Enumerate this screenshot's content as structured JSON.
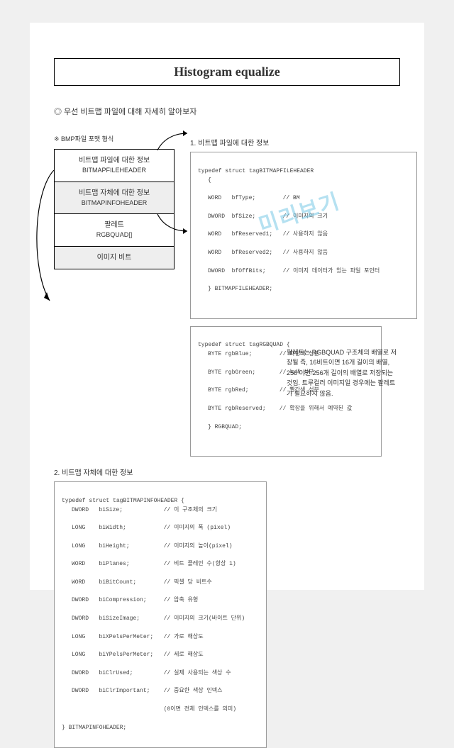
{
  "title": "Histogram  equalize",
  "intro": "◎ 우선 비트맵 파일에 대해 자세히 알아보자",
  "subhead_left": "※ BMP파일 포맷 형식",
  "sec1_heading": "1. 비트맵 파일에 대한 정보",
  "stack": {
    "cell1": {
      "line1": "비트맵 파일에 대한 정보",
      "line2": "BITMAPFILEHEADER"
    },
    "cell2": {
      "line1": "비트맵 자체에 대한 정보",
      "line2": "BITMAPINFOHEADER"
    },
    "cell3": {
      "line1": "팔레트",
      "line2": "RGBQUAD[]"
    },
    "cell4": {
      "line1": "이미지 비트"
    }
  },
  "code_fileheader": {
    "open": "typedef struct tagBITMAPFILEHEADER",
    "brace": "{",
    "m1": "WORD   bfType;        // BM",
    "m2": "DWORD  bfSize;        // 이미지의 크기",
    "m3": "WORD   bfReserved1;   // 사용하지 않음",
    "m4": "WORD   bfReserved2;   // 사용하지 않음",
    "m5": "DWORD  bfOffBits;     // 이미지 데이터가 있는 파일 포인터",
    "close": "} BITMAPFILEHEADER;"
  },
  "code_rgbquad": {
    "open": "typedef struct tagRGBQUAD {",
    "m1": "BYTE rgbBlue;        // 파란색 성분",
    "m2": "BYTE rgbGreen;       // 녹색 성분",
    "m3": "BYTE rgbRed;         // 빨간색 성분",
    "m4": "BYTE rgbReserved;    // 확장을 위해서 예약된 값",
    "close": "} RGBQUAD;"
  },
  "sec2_heading": "2. 비트맵 자체에 대한 정보",
  "code_infoheader": {
    "open": "typedef struct tagBITMAPINFOHEADER {",
    "m1": "DWORD   biSize;            // 이 구조체의 크기",
    "m2": "LONG    biWidth;           // 이미지의 폭 (pixel)",
    "m3": "LONG    biHeight;          // 이미지의 높이(pixel)",
    "m4": "WORD    biPlanes;          // 비트 플레인 수(항상 1)",
    "m5": "WORD    biBitCount;        // 픽셀 당 비트수",
    "m6": "DWORD   biCompression;     // 압축 유형",
    "m7": "DWORD   biSizeImage;       // 이미지의 크기(바이트 단위)",
    "m8": "LONG    biXPelsPerMeter;   // 가로 해상도",
    "m9": "LONG    biYPelsPerMeter;   // 세로 해상도",
    "m10": "DWORD   biClrUsed;         // 실제 사용되는 색상 수",
    "m11": "DWORD   biClrImportant;    // 중요한 색상 인덱스",
    "m12": "                           (0이면 전체 인덱스를 의미)",
    "close": "} BITMAPINFOHEADER;"
  },
  "palette_note": "팔레트는 RGBQUAD 구조체의 배열로 저장될 즉, 16비트이면 16개 길이의 배열, 256 이면 256개 길이의 배열로 저장되는 것임.\n트루컬러 이미지일 경우에는 팔레트가 필요하지 않음.",
  "watermark": "미리보기"
}
